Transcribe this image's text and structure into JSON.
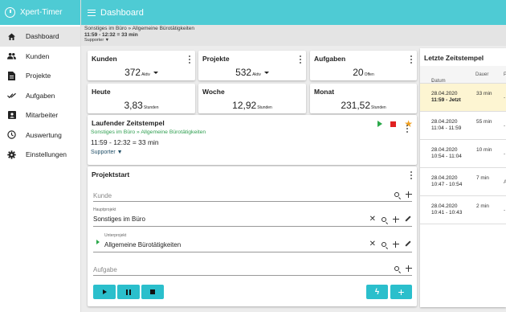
{
  "app": {
    "title": "Xpert-Timer"
  },
  "topbar": {
    "title": "Dashboard"
  },
  "subbar": {
    "line1": "Sonstiges im Büro » Allgemeine Bürotätigkeiten",
    "line2": "11:59 - 12:32 = 33 min",
    "line3": "Supporter ▼"
  },
  "sidebar": {
    "items": [
      {
        "label": "Dashboard",
        "icon": "home-icon",
        "active": true
      },
      {
        "label": "Kunden",
        "icon": "people-icon"
      },
      {
        "label": "Projekte",
        "icon": "document-icon"
      },
      {
        "label": "Aufgaben",
        "icon": "checkmarks-icon"
      },
      {
        "label": "Mitarbeiter",
        "icon": "badge-icon"
      },
      {
        "label": "Auswertung",
        "icon": "clock-icon"
      },
      {
        "label": "Einstellungen",
        "icon": "gear-icon"
      }
    ]
  },
  "cards": {
    "kunden": {
      "title": "Kunden",
      "value": "372",
      "unit": "Aktiv"
    },
    "projekte": {
      "title": "Projekte",
      "value": "532",
      "unit": "Aktiv"
    },
    "aufgaben": {
      "title": "Aufgaben",
      "value": "20",
      "unit": "Offen"
    },
    "heute": {
      "title": "Heute",
      "value": "3,83",
      "unit": "Stunden"
    },
    "woche": {
      "title": "Woche",
      "value": "12,92",
      "unit": "Stunden"
    },
    "monat": {
      "title": "Monat",
      "value": "231,52",
      "unit": "Stunden"
    }
  },
  "running": {
    "title": "Laufender Zeitstempel",
    "path": "Sonstiges im Büro » Allgemeine Bürotätigkeiten",
    "time": "11:59 -  12:32  = 33 min",
    "role": "Supporter ▼"
  },
  "projektstart": {
    "title": "Projektstart",
    "kunde_placeholder": "Kunde",
    "hauptprojekt_label": "Hauptprojekt",
    "hauptprojekt_value": "Sonstiges im Büro",
    "unterprojekt_label": "Unterprojekt",
    "unterprojekt_value": "Allgemeine Bürotätigkeiten",
    "aufgabe_placeholder": "Aufgabe"
  },
  "timestamps": {
    "title": "Letzte Zeitstempel",
    "col_datum": "Datum",
    "col_dauer": "Dauer",
    "col_extra": "P",
    "rows": [
      {
        "date": "28.04.2020",
        "time": "11:59 - Jetzt",
        "dur": "33 min",
        "extra": "-"
      },
      {
        "date": "28.04.2020",
        "time": "11:04 - 11:59",
        "dur": "55 min",
        "extra": "-"
      },
      {
        "date": "28.04.2020",
        "time": "10:54 - 11:04",
        "dur": "10 min",
        "extra": "-"
      },
      {
        "date": "28.04.2020",
        "time": "10:47 - 10:54",
        "dur": "7 min",
        "extra": "A"
      },
      {
        "date": "28.04.2020",
        "time": "10:41 - 10:43",
        "dur": "2 min",
        "extra": "-"
      }
    ]
  },
  "colors": {
    "accent": "#4ecbd4",
    "green": "#2ba84a",
    "red": "#e02020",
    "star": "#f0a020",
    "highlight": "#fdf5d2"
  }
}
